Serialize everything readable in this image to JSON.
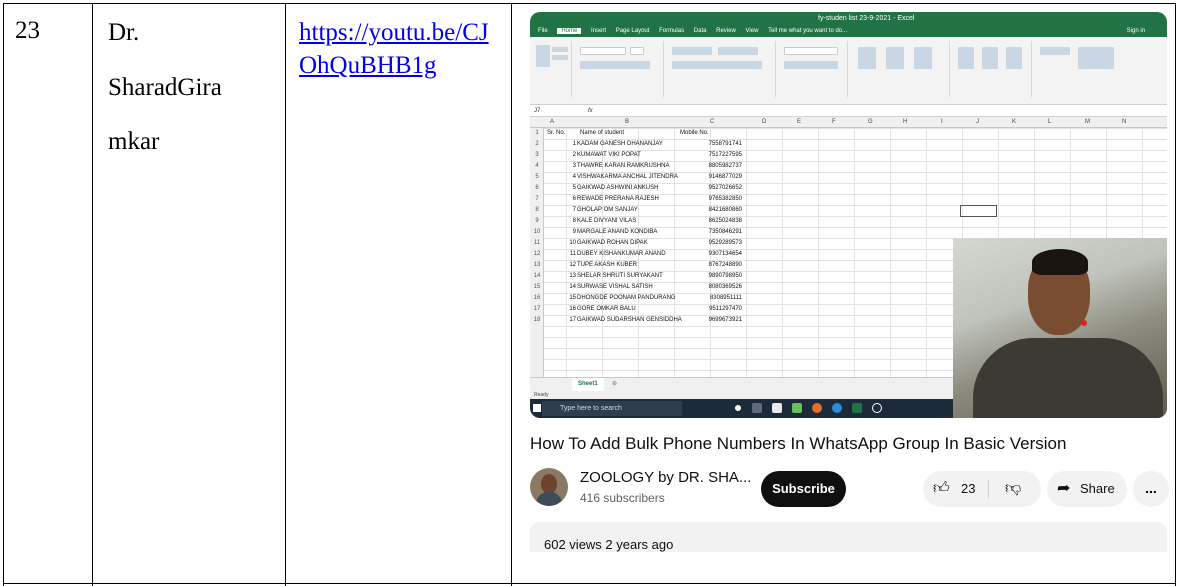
{
  "row": {
    "number": "23",
    "name_line1": "Dr.",
    "name_line2": "SharadGira",
    "name_line3": "mkar",
    "link": "https://youtu.be/CJOhQuBHB1g"
  },
  "excel": {
    "title": "fy-studen list 23-9-2021 - Excel",
    "menu": [
      "File",
      "Home",
      "Insert",
      "Page Layout",
      "Formulas",
      "Data",
      "Review",
      "View",
      "Tell me what you want to do..."
    ],
    "sign_in": "Sign in",
    "name_box": "J7",
    "columns": [
      "A",
      "B",
      "C",
      "D",
      "E",
      "F",
      "G",
      "H",
      "I",
      "J",
      "K",
      "L",
      "M",
      "N"
    ],
    "header": {
      "sr": "Sr. No.",
      "name": "Name of student",
      "mobile": "Mobile No."
    },
    "rows": [
      {
        "sr": "1",
        "name": "KADAM GANESH DHANANJAY",
        "mobile": "7558791741"
      },
      {
        "sr": "2",
        "name": "KUMAWAT VIKI POPAT",
        "mobile": "7517227595"
      },
      {
        "sr": "3",
        "name": "THAWRE KARAN RAMKRUSHNA",
        "mobile": "8805982737"
      },
      {
        "sr": "4",
        "name": "VISHWAKARMA ANCHAL JITENDRA",
        "mobile": "9146877029"
      },
      {
        "sr": "5",
        "name": "GAIKWAD ASHWINI ANKUSH",
        "mobile": "9527026652"
      },
      {
        "sr": "6",
        "name": "REWADE PRERANA RAJESH",
        "mobile": "9765382850"
      },
      {
        "sr": "7",
        "name": "GHOLAP OM SANJAY",
        "mobile": "8421680860"
      },
      {
        "sr": "8",
        "name": "KALE DIVYANI VILAS",
        "mobile": "8625024838"
      },
      {
        "sr": "9",
        "name": "MARGALE ANAND KONDIBA",
        "mobile": "7350846291"
      },
      {
        "sr": "10",
        "name": "GAIKWAD ROHAN DIPAK",
        "mobile": "9529289573"
      },
      {
        "sr": "11",
        "name": "DUBEY KISHANKUMAR ANAND",
        "mobile": "9307134654"
      },
      {
        "sr": "12",
        "name": "TUPE AKASH KUBER",
        "mobile": "8767248890"
      },
      {
        "sr": "13",
        "name": "SHELAR SHRUTI SURYAKANT",
        "mobile": "9890798950"
      },
      {
        "sr": "14",
        "name": "SURWASE VISHAL SATISH",
        "mobile": "8080369526"
      },
      {
        "sr": "15",
        "name": "DHONGDE POONAM PANDURANG",
        "mobile": "8308951111"
      },
      {
        "sr": "16",
        "name": "GORE OMKAR BALU",
        "mobile": "9511297470"
      },
      {
        "sr": "17",
        "name": "GAIKWAD SUDARSHAN GENSIDDHA",
        "mobile": "9699673921"
      }
    ],
    "sheet_tab": "Sheet1",
    "status": "Ready",
    "taskbar_search": "Type here to search"
  },
  "video": {
    "title": "How To Add Bulk Phone Numbers In WhatsApp Group In Basic Version",
    "channel": "ZOOLOGY by DR. SHA...",
    "subscribers": "416 subscribers",
    "subscribe_label": "Subscribe",
    "likes": "23",
    "share_label": "Share",
    "more_label": "...",
    "views": "602 views  2 years ago"
  }
}
